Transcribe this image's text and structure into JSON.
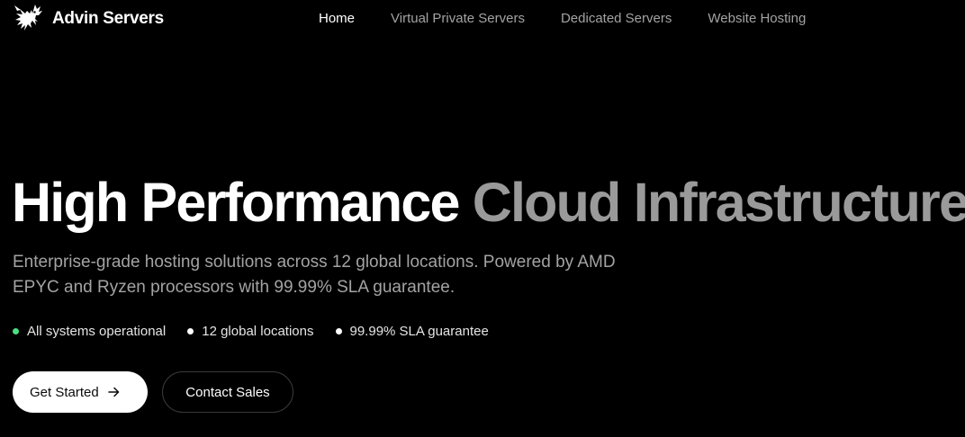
{
  "brand": {
    "name": "Advin Servers",
    "logo_icon": "eagle-icon"
  },
  "nav": {
    "items": [
      {
        "label": "Home",
        "active": true
      },
      {
        "label": "Virtual Private Servers",
        "active": false
      },
      {
        "label": "Dedicated Servers",
        "active": false
      },
      {
        "label": "Website Hosting",
        "active": false
      }
    ]
  },
  "hero": {
    "title_primary": "High Performance",
    "title_secondary": "Cloud Infrastructure",
    "description": "Enterprise-grade hosting solutions across 12 global locations. Powered by AMD EPYC and Ryzen processors with 99.99% SLA guarantee.",
    "status": [
      {
        "label": "All systems operational",
        "dot_color": "#4ade80"
      },
      {
        "label": "12 global locations",
        "dot_color": "#ffffff"
      },
      {
        "label": "99.99% SLA guarantee",
        "dot_color": "#ffffff"
      }
    ],
    "primary_button": {
      "label": "Get Started",
      "icon": "arrow-right-icon"
    },
    "secondary_button": {
      "label": "Contact Sales"
    }
  },
  "colors": {
    "background": "#000000",
    "text_primary": "#ffffff",
    "text_muted": "#a3a3a3",
    "accent_green": "#4ade80"
  }
}
